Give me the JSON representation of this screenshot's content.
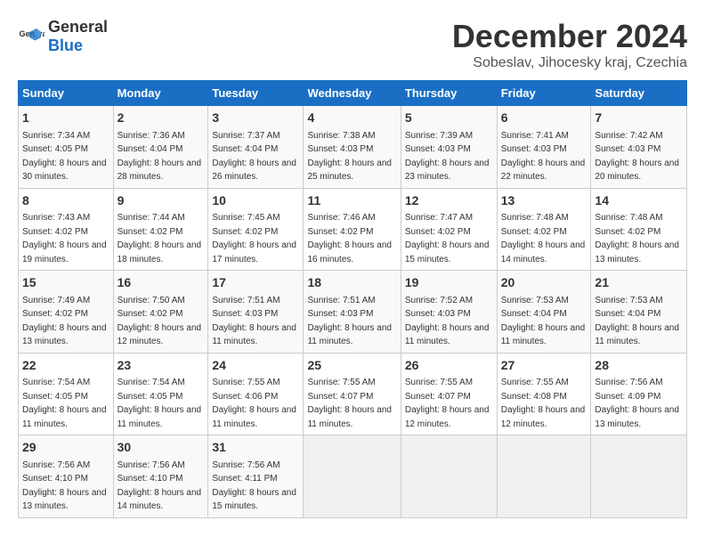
{
  "logo": {
    "general": "General",
    "blue": "Blue"
  },
  "title": "December 2024",
  "subtitle": "Sobeslav, Jihocesky kraj, Czechia",
  "headers": [
    "Sunday",
    "Monday",
    "Tuesday",
    "Wednesday",
    "Thursday",
    "Friday",
    "Saturday"
  ],
  "weeks": [
    [
      {
        "day": "1",
        "sunrise": "7:34 AM",
        "sunset": "4:05 PM",
        "daylight": "8 hours and 30 minutes."
      },
      {
        "day": "2",
        "sunrise": "7:36 AM",
        "sunset": "4:04 PM",
        "daylight": "8 hours and 28 minutes."
      },
      {
        "day": "3",
        "sunrise": "7:37 AM",
        "sunset": "4:04 PM",
        "daylight": "8 hours and 26 minutes."
      },
      {
        "day": "4",
        "sunrise": "7:38 AM",
        "sunset": "4:03 PM",
        "daylight": "8 hours and 25 minutes."
      },
      {
        "day": "5",
        "sunrise": "7:39 AM",
        "sunset": "4:03 PM",
        "daylight": "8 hours and 23 minutes."
      },
      {
        "day": "6",
        "sunrise": "7:41 AM",
        "sunset": "4:03 PM",
        "daylight": "8 hours and 22 minutes."
      },
      {
        "day": "7",
        "sunrise": "7:42 AM",
        "sunset": "4:03 PM",
        "daylight": "8 hours and 20 minutes."
      }
    ],
    [
      {
        "day": "8",
        "sunrise": "7:43 AM",
        "sunset": "4:02 PM",
        "daylight": "8 hours and 19 minutes."
      },
      {
        "day": "9",
        "sunrise": "7:44 AM",
        "sunset": "4:02 PM",
        "daylight": "8 hours and 18 minutes."
      },
      {
        "day": "10",
        "sunrise": "7:45 AM",
        "sunset": "4:02 PM",
        "daylight": "8 hours and 17 minutes."
      },
      {
        "day": "11",
        "sunrise": "7:46 AM",
        "sunset": "4:02 PM",
        "daylight": "8 hours and 16 minutes."
      },
      {
        "day": "12",
        "sunrise": "7:47 AM",
        "sunset": "4:02 PM",
        "daylight": "8 hours and 15 minutes."
      },
      {
        "day": "13",
        "sunrise": "7:48 AM",
        "sunset": "4:02 PM",
        "daylight": "8 hours and 14 minutes."
      },
      {
        "day": "14",
        "sunrise": "7:48 AM",
        "sunset": "4:02 PM",
        "daylight": "8 hours and 13 minutes."
      }
    ],
    [
      {
        "day": "15",
        "sunrise": "7:49 AM",
        "sunset": "4:02 PM",
        "daylight": "8 hours and 13 minutes."
      },
      {
        "day": "16",
        "sunrise": "7:50 AM",
        "sunset": "4:02 PM",
        "daylight": "8 hours and 12 minutes."
      },
      {
        "day": "17",
        "sunrise": "7:51 AM",
        "sunset": "4:03 PM",
        "daylight": "8 hours and 11 minutes."
      },
      {
        "day": "18",
        "sunrise": "7:51 AM",
        "sunset": "4:03 PM",
        "daylight": "8 hours and 11 minutes."
      },
      {
        "day": "19",
        "sunrise": "7:52 AM",
        "sunset": "4:03 PM",
        "daylight": "8 hours and 11 minutes."
      },
      {
        "day": "20",
        "sunrise": "7:53 AM",
        "sunset": "4:04 PM",
        "daylight": "8 hours and 11 minutes."
      },
      {
        "day": "21",
        "sunrise": "7:53 AM",
        "sunset": "4:04 PM",
        "daylight": "8 hours and 11 minutes."
      }
    ],
    [
      {
        "day": "22",
        "sunrise": "7:54 AM",
        "sunset": "4:05 PM",
        "daylight": "8 hours and 11 minutes."
      },
      {
        "day": "23",
        "sunrise": "7:54 AM",
        "sunset": "4:05 PM",
        "daylight": "8 hours and 11 minutes."
      },
      {
        "day": "24",
        "sunrise": "7:55 AM",
        "sunset": "4:06 PM",
        "daylight": "8 hours and 11 minutes."
      },
      {
        "day": "25",
        "sunrise": "7:55 AM",
        "sunset": "4:07 PM",
        "daylight": "8 hours and 11 minutes."
      },
      {
        "day": "26",
        "sunrise": "7:55 AM",
        "sunset": "4:07 PM",
        "daylight": "8 hours and 12 minutes."
      },
      {
        "day": "27",
        "sunrise": "7:55 AM",
        "sunset": "4:08 PM",
        "daylight": "8 hours and 12 minutes."
      },
      {
        "day": "28",
        "sunrise": "7:56 AM",
        "sunset": "4:09 PM",
        "daylight": "8 hours and 13 minutes."
      }
    ],
    [
      {
        "day": "29",
        "sunrise": "7:56 AM",
        "sunset": "4:10 PM",
        "daylight": "8 hours and 13 minutes."
      },
      {
        "day": "30",
        "sunrise": "7:56 AM",
        "sunset": "4:10 PM",
        "daylight": "8 hours and 14 minutes."
      },
      {
        "day": "31",
        "sunrise": "7:56 AM",
        "sunset": "4:11 PM",
        "daylight": "8 hours and 15 minutes."
      },
      null,
      null,
      null,
      null
    ]
  ]
}
